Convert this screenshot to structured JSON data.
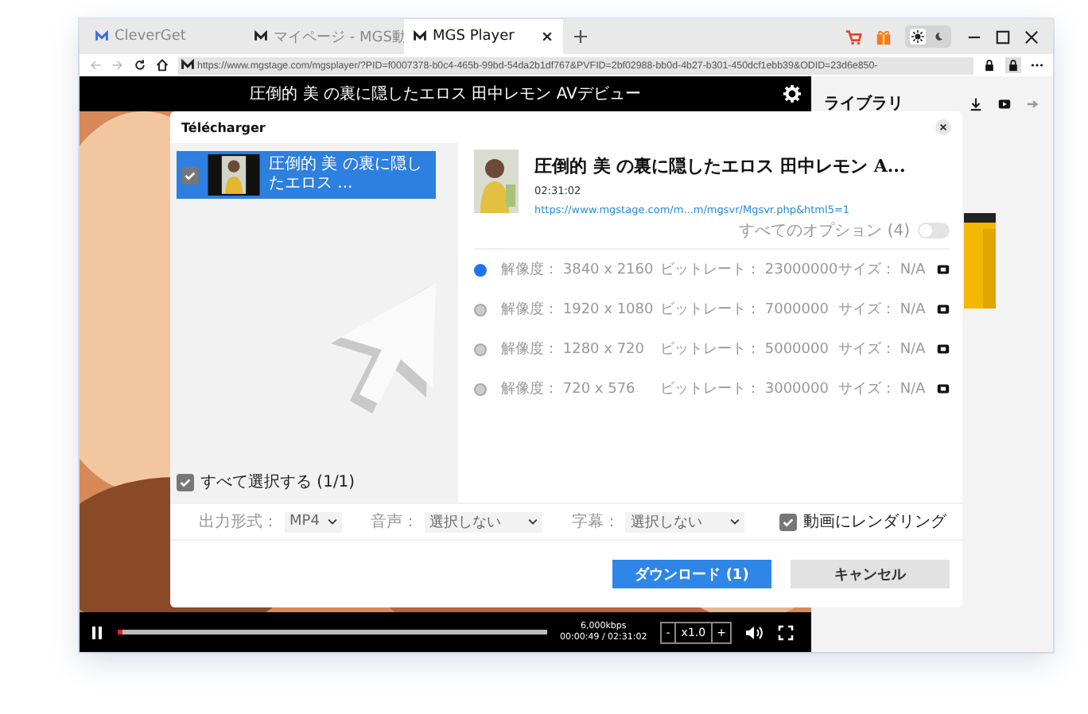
{
  "browser": {
    "tabs": [
      {
        "label": "CleverGet",
        "selected": false
      },
      {
        "label": "マイページ - MGS動",
        "selected": false
      },
      {
        "label": "MGS Player",
        "selected": true
      }
    ],
    "dark_theme": false,
    "url": "https://www.mgstage.com/mgsplayer/?PID=f0007378-b0c4-465b-99bd-54da2b1df767&PVFID=2bf02988-bb0d-4b27-b301-450dcf1ebb39&ODID=23d6e850-"
  },
  "player": {
    "title": "圧倒的 美 の裏に隠したエロス 田中レモン AVデビュー",
    "bitrate": "6,000kbps",
    "time": "00:00:49 / 02:31:02",
    "speed_down": "-",
    "speed": "x1.0",
    "speed_up": "+",
    "level": 0.01
  },
  "library": {
    "title": "ライブラリ"
  },
  "dialog": {
    "title": "Télécharger",
    "items": [
      {
        "title": "圧倒的 美 の裏に隠したエロス ...",
        "checked": true,
        "selected": true
      }
    ],
    "select_all": {
      "label": "すべて選択する (1/1)",
      "checked": true
    },
    "detail": {
      "title": "圧倒的 美 の裏に隠したエロス 田中レモン A...",
      "duration": "02:31:02",
      "link": "https://www.mgstage.com/m...m/mgsvr/Mgsvr.php&html5=1"
    },
    "all_options": {
      "label": "すべてのオプション (4)",
      "on": false
    },
    "options": [
      {
        "resolution": "解像度： 3840 x 2160",
        "bitrate": "ビットレート： 23000000",
        "size": "サイズ： N/A",
        "selected": true
      },
      {
        "resolution": "解像度： 1920 x 1080",
        "bitrate": "ビットレート： 7000000",
        "size": "サイズ： N/A",
        "selected": false
      },
      {
        "resolution": "解像度： 1280 x 720",
        "bitrate": "ビットレート： 5000000",
        "size": "サイズ： N/A",
        "selected": false
      },
      {
        "resolution": "解像度： 720 x 576",
        "bitrate": "ビットレート： 3000000",
        "size": "サイズ： N/A",
        "selected": false
      }
    ],
    "format": {
      "label": "出力形式：",
      "value": "MP4"
    },
    "audio": {
      "label": "音声：",
      "value": "選択しない"
    },
    "subtitle": {
      "label": "字幕：",
      "value": "選択しない"
    },
    "render": {
      "label": "動画にレンダリング",
      "checked": true
    },
    "download_button": "ダウンロード (1)",
    "cancel_button": "キャンセル"
  }
}
